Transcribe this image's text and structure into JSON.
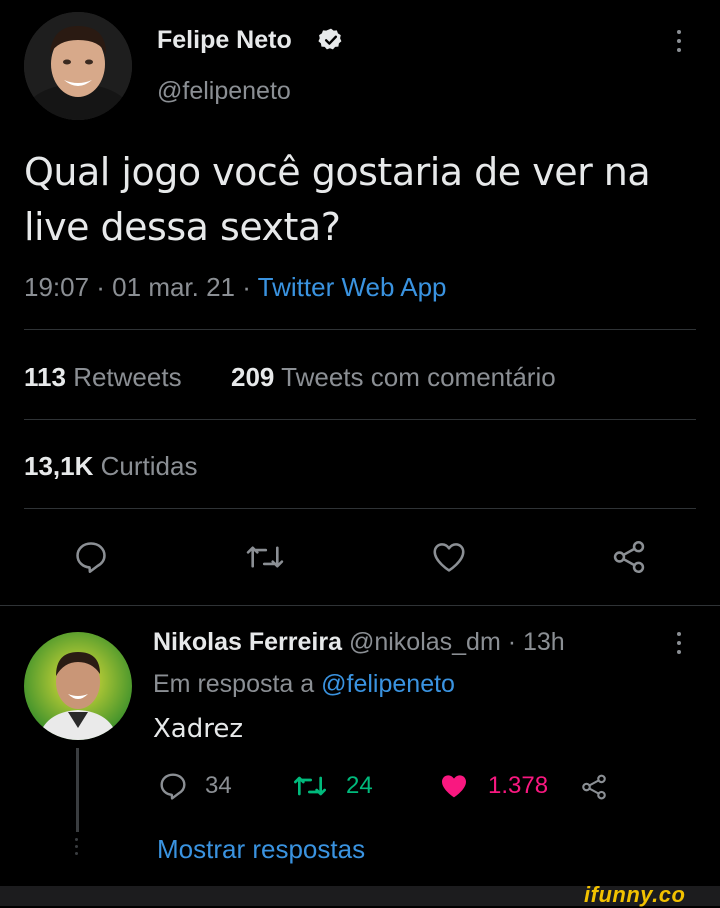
{
  "tweet": {
    "author_name": "Felipe Neto",
    "author_handle": "@felipeneto",
    "text_line1": "Qual jogo você gostaria de ver na",
    "text_line2": "live dessa sexta?",
    "timestamp": "19:07 · 01 mar. 21 · ",
    "source": "Twitter Web App",
    "retweets_count": "113",
    "retweets_label": "Retweets",
    "quotes_count": "209",
    "quotes_label": "Tweets com comentário",
    "likes_count": "13,1K",
    "likes_label": "Curtidas"
  },
  "reply": {
    "author_name": "Nikolas Ferreira",
    "author_handle_time": "@nikolas_dm · 13h",
    "in_reply_prefix": "Em resposta a ",
    "in_reply_handle": "@felipeneto",
    "text": "Xadrez",
    "reply_count": "34",
    "retweet_count": "24",
    "like_count": "1.378",
    "show_replies": "Mostrar respostas"
  },
  "watermark": "ifunny.co",
  "colors": {
    "background": "#000000",
    "link": "#3a93e0",
    "retweet_green": "#00ba7c",
    "like_red": "#f91880"
  }
}
